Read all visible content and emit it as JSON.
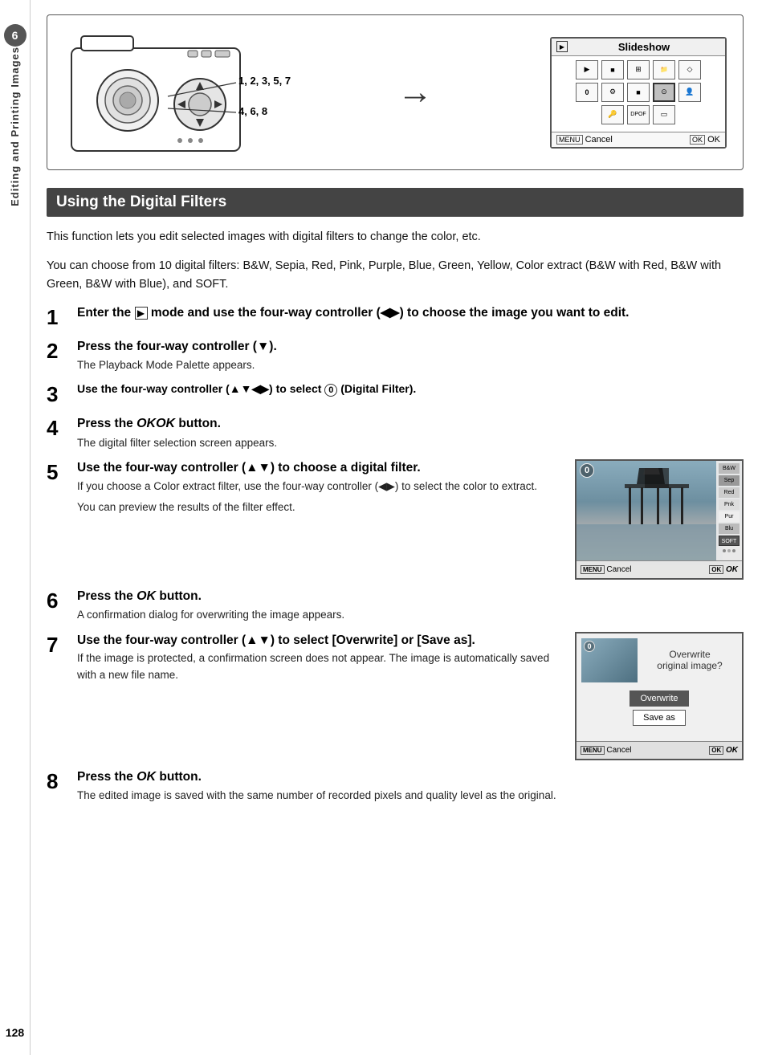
{
  "sidebar": {
    "chapter_number": "6",
    "chapter_label": "Editing and Printing Images",
    "page_number": "128"
  },
  "diagram": {
    "label1": "1, 2, 3, 5, 7",
    "label2": "4, 6, 8",
    "screen_title": "Slideshow",
    "menu_cancel": "Cancel",
    "menu_ok": "OK"
  },
  "section": {
    "title": "Using the Digital Filters"
  },
  "intro": {
    "line1": "This function lets you edit selected images with digital filters to change the color, etc.",
    "line2": "You can choose from 10 digital filters: B&W, Sepia, Red, Pink, Purple, Blue, Green, Yellow, Color extract (B&W with Red, B&W with Green, B&W with Blue), and SOFT."
  },
  "steps": [
    {
      "number": "1",
      "title_prefix": "Enter the",
      "title_icon": "▶",
      "title_suffix": " mode and use the four-way controller (◀▶) to choose the image you want to edit."
    },
    {
      "number": "2",
      "title": "Press the four-way controller (▼).",
      "desc": "The Playback Mode Palette appears."
    },
    {
      "number": "3",
      "title": "Use the four-way controller (▲▼◀▶) to select 0 (Digital Filter)."
    },
    {
      "number": "4",
      "title_prefix": "Press the",
      "title_ok": "OK",
      "title_suffix": " button.",
      "desc": "The digital filter selection screen appears."
    },
    {
      "number": "5",
      "title": "Use the four-way controller (▲▼) to choose a digital filter.",
      "desc1": "If you choose a Color extract filter, use the four-way controller (◀▶) to select the color to extract.",
      "desc2": "You can preview the results of the filter effect.",
      "screen": {
        "menu_cancel": "Cancel",
        "ok_label": "OK",
        "soft_label": "SOFT"
      }
    },
    {
      "number": "6",
      "title_prefix": "Press the",
      "title_ok": "OK",
      "title_suffix": " button.",
      "desc": "A confirmation dialog for overwriting the image appears."
    },
    {
      "number": "7",
      "title": "Use the four-way controller (▲▼) to select [Overwrite] or [Save as].",
      "desc1": "If the image is protected, a confirmation screen does not appear. The image is automatically saved with a new file name.",
      "screen": {
        "overwrite_text1": "Overwrite",
        "overwrite_text2": "original image?",
        "btn1": "Overwrite",
        "btn2": "Save as",
        "menu_cancel": "Cancel",
        "ok_label": "OK"
      }
    },
    {
      "number": "8",
      "title_prefix": "Press the",
      "title_ok": "OK",
      "title_suffix": " button.",
      "desc": "The edited image is saved with the same number of recorded pixels and quality level as the original."
    }
  ]
}
